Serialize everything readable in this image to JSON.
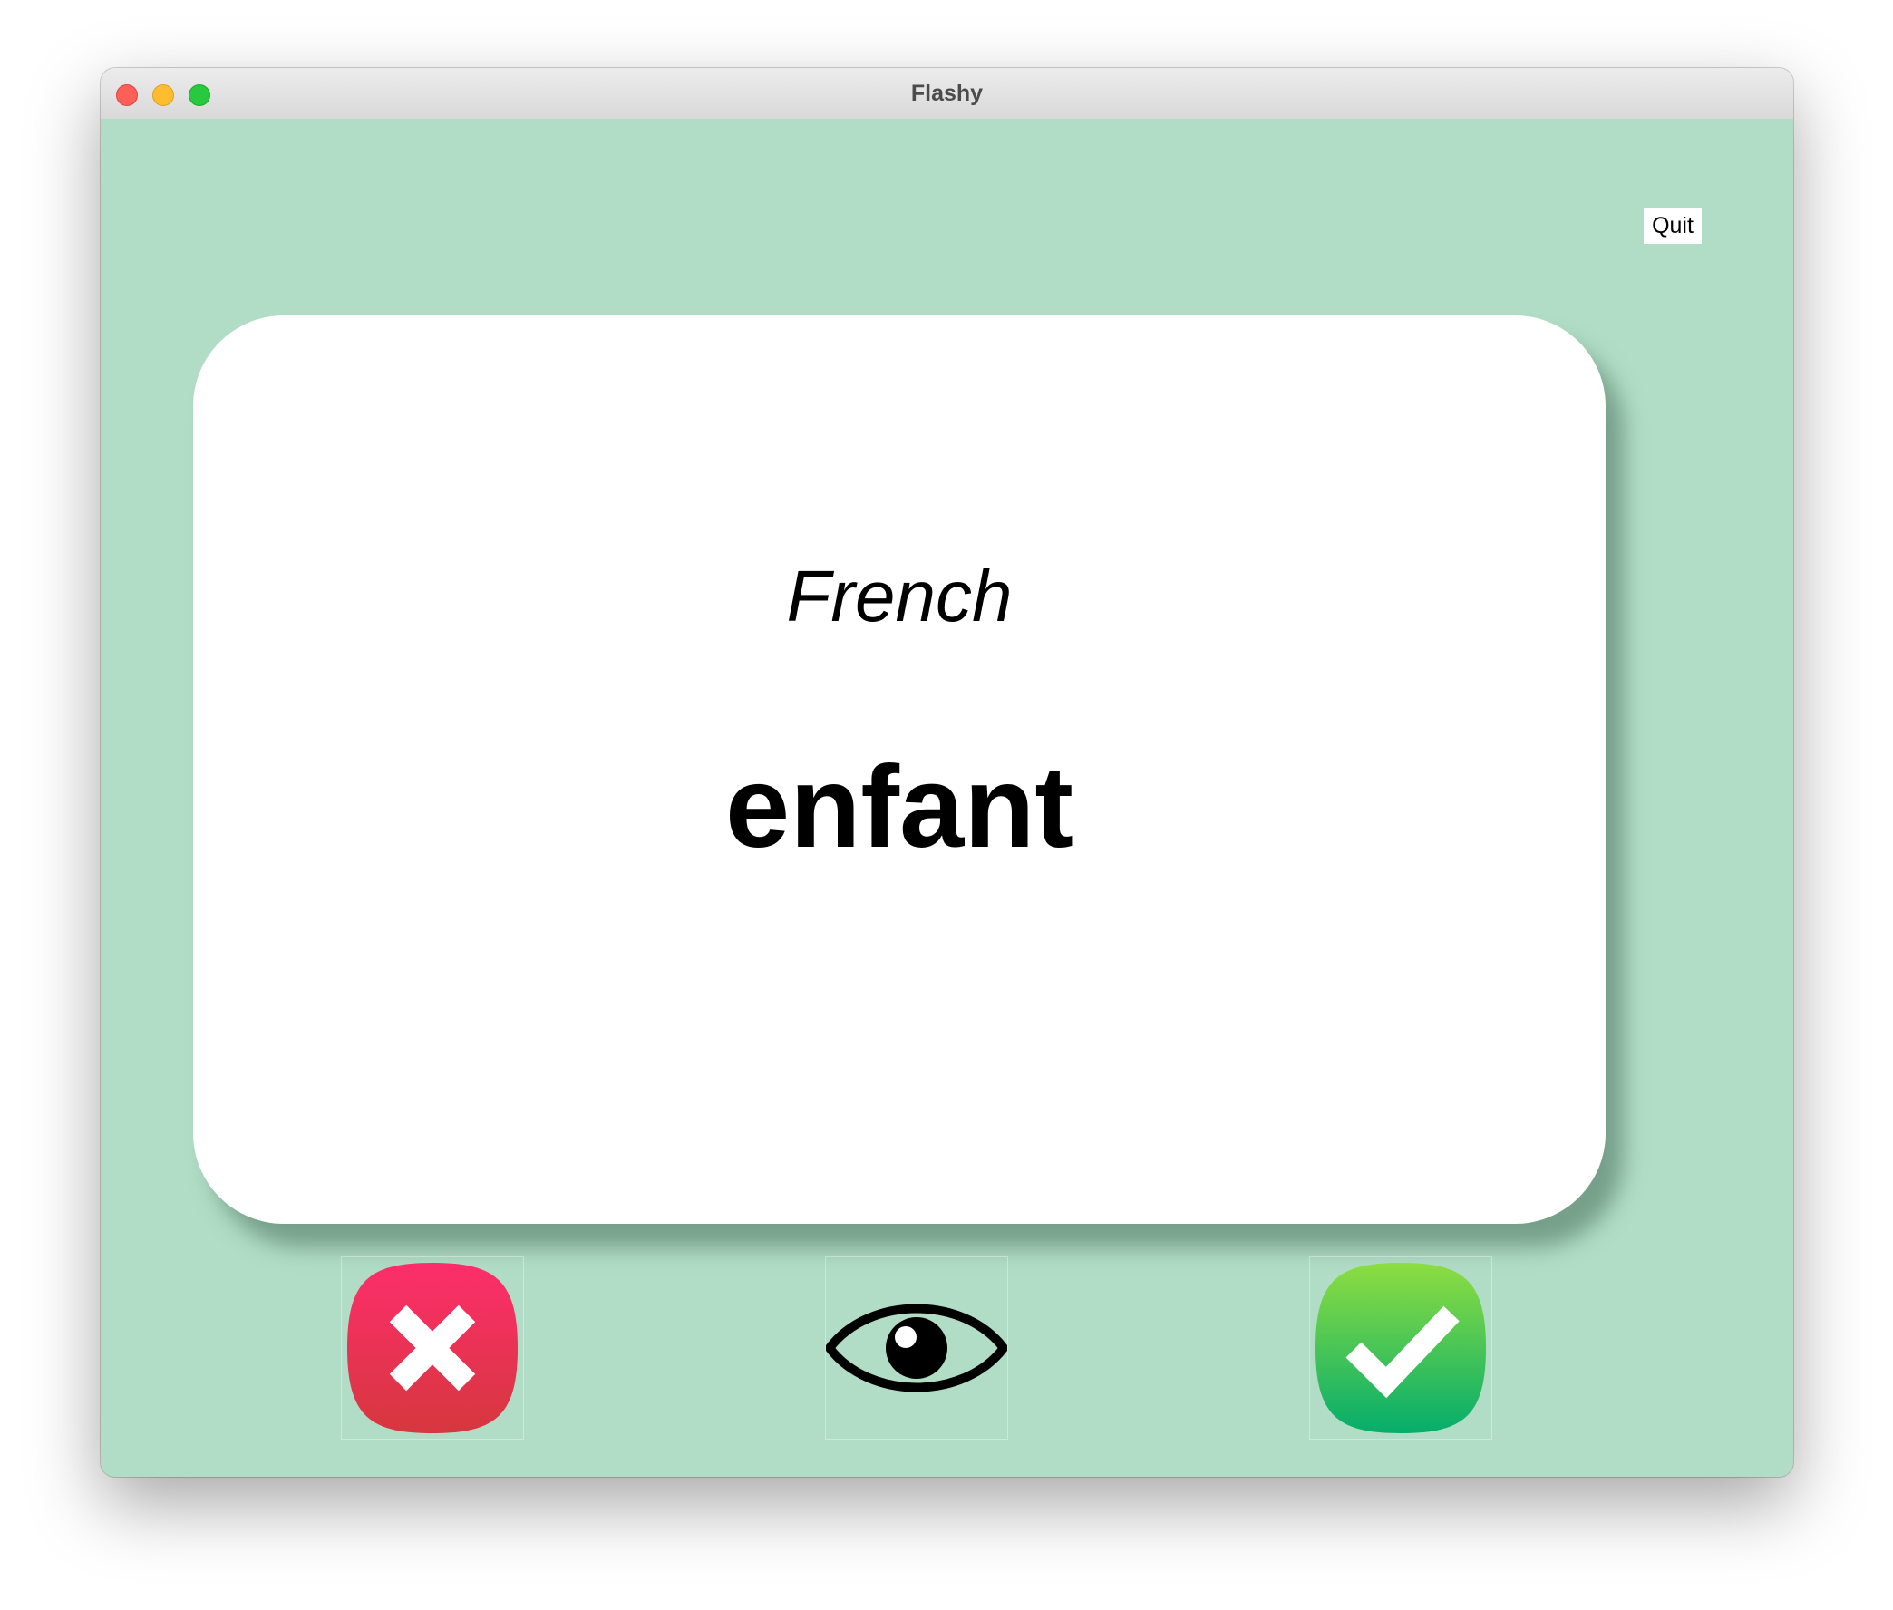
{
  "window": {
    "title": "Flashy"
  },
  "toolbar": {
    "quit_label": "Quit"
  },
  "card": {
    "title": "French",
    "word": "enfant"
  },
  "actions": {
    "wrong_icon": "x-mark-icon",
    "flip_icon": "eye-icon",
    "right_icon": "checkmark-icon"
  },
  "colors": {
    "background": "#b1ddc6",
    "card": "#ffffff",
    "wrong_top": "#fd2e6b",
    "wrong_bottom": "#d6373e",
    "right_top": "#8ddd40",
    "right_bottom": "#05ad6c"
  }
}
